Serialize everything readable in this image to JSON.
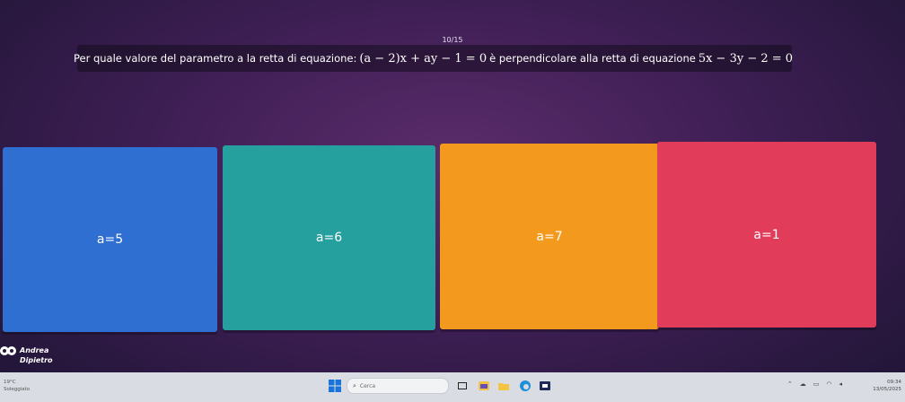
{
  "quiz": {
    "progress": "10/15",
    "question": {
      "prefix": "Per quale valore del parametro a la retta di equazione:",
      "equation1": "(a − 2)x + ay − 1 = 0",
      "middle": "è perpendicolare alla retta di equazione",
      "equation2": "5x − 3y − 2 = 0"
    },
    "answers": [
      {
        "label": "a=5",
        "color": "#2f6fd1"
      },
      {
        "label": "a=6",
        "color": "#26a09e"
      },
      {
        "label": "a=7",
        "color": "#f39a1e"
      },
      {
        "label": "a=1",
        "color": "#e23c5b"
      }
    ]
  },
  "player": {
    "first_name": "Andrea",
    "last_name": "Dipietro"
  },
  "taskbar": {
    "weather": {
      "temp": "19°C",
      "condition": "Soleggiato"
    },
    "search_placeholder": "Cerca",
    "time": "09:34",
    "date": "13/05/2025"
  }
}
